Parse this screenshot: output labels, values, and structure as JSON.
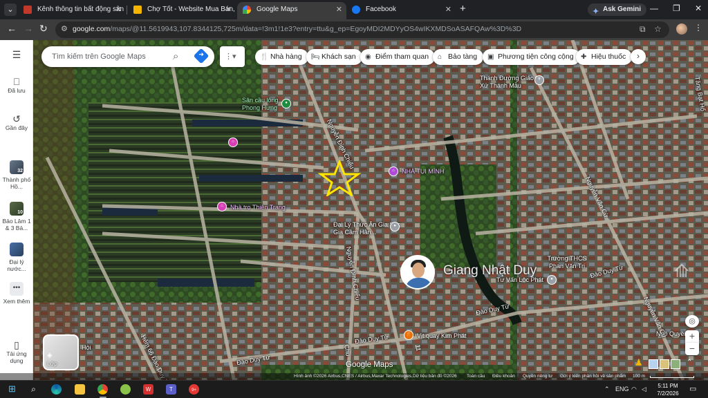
{
  "browser": {
    "tabs": [
      {
        "title": "Kênh thông tin bất động sản - N",
        "favicon_color": "#c0392b"
      },
      {
        "title": "Chợ Tốt - Website Mua Bán, Ra",
        "favicon_color": "#f4b400"
      },
      {
        "title": "Google Maps",
        "favicon_color": "#34a853"
      },
      {
        "title": "Facebook",
        "favicon_color": "#1877f2"
      }
    ],
    "new_tab_label": "+",
    "ask_gemini_label": "Ask Gemini",
    "url_host": "google.com",
    "url_path": "/maps/@11.5619943,107.8344125,725m/data=!3m1!1e3?entry=ttu&g_ep=EgoyMDI2MDYyOS4wIKXMDSoASAFQAw%3D%3D"
  },
  "maps": {
    "search_placeholder": "Tìm kiếm trên Google Maps",
    "rail": [
      {
        "label": "Đã lưu",
        "icon": "bookmark-icon"
      },
      {
        "label": "Gần đây",
        "icon": "history-icon"
      },
      {
        "label": "Thành phố Hồ...",
        "icon": "thumbnail-icon"
      },
      {
        "label": "Bảo Lâm 1 & 3 Bả...",
        "icon": "thumbnail-icon"
      },
      {
        "label": "Đại lý nước...",
        "icon": "thumbnail-icon"
      },
      {
        "label": "Xem thêm",
        "icon": "more-icon"
      },
      {
        "label": "Tải ứng dụng",
        "icon": "phone-icon"
      }
    ],
    "rail_badges": [
      "32",
      "10"
    ],
    "chips": [
      {
        "label": "Nhà hàng",
        "icon": "restaurant-icon"
      },
      {
        "label": "Khách sạn",
        "icon": "hotel-icon"
      },
      {
        "label": "Điểm tham quan",
        "icon": "camera-icon"
      },
      {
        "label": "Bảo tàng",
        "icon": "museum-icon"
      },
      {
        "label": "Phương tiện công cộng",
        "icon": "transit-icon"
      },
      {
        "label": "Hiệu thuốc",
        "icon": "pharmacy-icon"
      }
    ],
    "layers_label": "Lớp",
    "map_labels": {
      "thanh_duong": "Thánh Đường Giáo Xứ Thánh Mẫu",
      "san_cau_long": "Sân cầu lông Phong Hưng",
      "nha_tui_minh": "NHÀ TỤI MÌNH",
      "nha_tro": "Nhà trọ Thiên Trang",
      "dai_ly": "Đại Lý Thức Ăn Gia Súc Gia Cầm Hân...",
      "truong_thcs": "Trường THCS Phan Văn Trị",
      "tu_van": "Tư Vấn Lộc Phát",
      "vit_quay": "Vịt quay Kim Phát",
      "ngo_quyen": "Ngô Quyền",
      "nguyen_dinh_chieu": "Nguyễn Đình Chiểu",
      "nguyen_dinh_chieu_2": "Nguyễn Đình Chiểu",
      "nguyen_van_cu": "Nguyễn Văn Cừ",
      "nguyen_van_cu_2": "Nguyễn Văn Cừ",
      "dao_duy_tu_1": "Đào Duy Từ",
      "dao_duy_tu_2": "Đào Duy Từ",
      "dao_duy_tu_3": "Đào Duy Từ",
      "dao_duy_tu_4": "Đào Duy Từ",
      "hem_dao_duy_tu": "Hẻm 66 Đào Duy Từ",
      "tang_bat_ho": "Tăng Bạt Hổ",
      "chu_1": "Chu",
      "hoi": "Hội",
      "road_11": "11"
    },
    "agent_name": "Giang Nhật Duy",
    "google_maps_logo": "Google Maps",
    "attribution": {
      "imagery": "Hình ảnh ©2026 Airbus,CNES / Airbus,Maxar Technologies,Dữ liệu bản đồ ©2026",
      "country": "Toàn cầu",
      "terms": "Điều khoản",
      "privacy": "Quyền riêng tư",
      "feedback": "Gửi ý kiến phản hồi về sản phẩm",
      "scale": "100 m"
    }
  },
  "taskbar": {
    "language": "ENG",
    "time": "5:11 PM",
    "date": "7/2/2026",
    "notification_badge": "9+"
  },
  "colors": {
    "accent": "#1a73e8",
    "poi_pink": "#d93fb4",
    "poi_green": "#1e8e3e",
    "poi_gray": "#9aa0a6",
    "poi_orange": "#e8710a",
    "star": "#ffe600"
  }
}
